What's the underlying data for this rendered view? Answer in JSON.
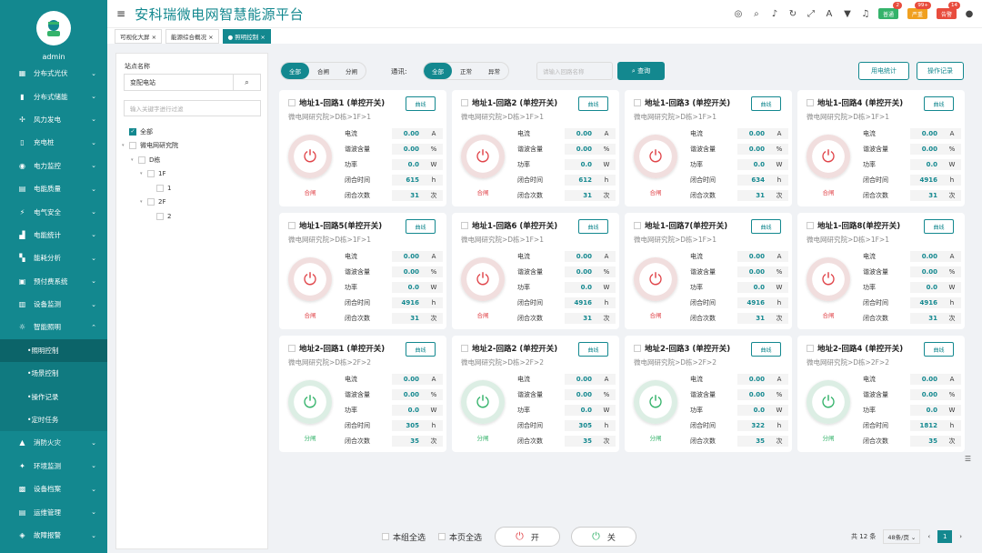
{
  "app": {
    "title": "安科瑞微电网智慧能源平台",
    "user": "admin"
  },
  "header_badges": [
    {
      "label": "普通",
      "count": "2",
      "color": "#35b36b"
    },
    {
      "label": "严重",
      "count": "99+",
      "color": "#f0a020"
    },
    {
      "label": "告警",
      "count": "14",
      "color": "#e84c3d"
    }
  ],
  "tabs": [
    "可视化大屏",
    "能源综合概况",
    "照明控制"
  ],
  "nav": [
    {
      "label": "分布式光伏",
      "icon": "solar-icon"
    },
    {
      "label": "分布式储能",
      "icon": "battery-icon"
    },
    {
      "label": "风力发电",
      "icon": "wind-icon"
    },
    {
      "label": "充电桩",
      "icon": "charger-icon"
    },
    {
      "label": "电力监控",
      "icon": "monitor-icon"
    },
    {
      "label": "电能质量",
      "icon": "quality-icon"
    },
    {
      "label": "电气安全",
      "icon": "safety-icon"
    },
    {
      "label": "电能统计",
      "icon": "stats-icon"
    },
    {
      "label": "能耗分析",
      "icon": "analysis-icon"
    },
    {
      "label": "预付费系统",
      "icon": "prepaid-icon"
    },
    {
      "label": "设备监测",
      "icon": "device-icon"
    },
    {
      "label": "智能照明",
      "icon": "bulb-icon"
    }
  ],
  "nav_sub": [
    "照明控制",
    "场景控制",
    "操作记录",
    "定时任务"
  ],
  "nav_after": [
    {
      "label": "消防火灾",
      "icon": "fire-icon"
    },
    {
      "label": "环境监测",
      "icon": "env-icon"
    },
    {
      "label": "设备档案",
      "icon": "archive-icon"
    },
    {
      "label": "运维管理",
      "icon": "maintenance-icon"
    },
    {
      "label": "故障报警",
      "icon": "alarm-icon"
    }
  ],
  "left": {
    "station_label": "站点名称",
    "station_value": "变配电站",
    "filter_placeholder": "输入关键字进行过滤",
    "tree": [
      "全部",
      "微电网研究院",
      "D栋",
      "1F",
      "1",
      "2F",
      "2"
    ]
  },
  "toolbar": {
    "filter1": [
      "全部",
      "合闸",
      "分闸"
    ],
    "comm_label": "通讯:",
    "filter2": [
      "全部",
      "正常",
      "异常"
    ],
    "search_placeholder": "请输入回路名称",
    "query": "查询",
    "usage_stats": "用电统计",
    "op_log": "操作记录"
  },
  "labels": {
    "current": "电流",
    "harmonic": "谐波含量",
    "power": "功率",
    "close_time": "闭合时间",
    "close_count": "闭合次数",
    "curve": "曲线"
  },
  "units": {
    "current": "A",
    "harmonic": "%",
    "power": "W",
    "close_time": "h",
    "close_count": "次"
  },
  "cards": [
    {
      "title": "地址1-回路1 (单控开关)",
      "path": "微电网研究院>D栋>1F>1",
      "state": "on",
      "state_label": "合闸",
      "current": "0.00",
      "harmonic": "0.00",
      "power": "0.0",
      "time": "615",
      "count": "31"
    },
    {
      "title": "地址1-回路2 (单控开关)",
      "path": "微电网研究院>D栋>1F>1",
      "state": "on",
      "state_label": "合闸",
      "current": "0.00",
      "harmonic": "0.00",
      "power": "0.0",
      "time": "612",
      "count": "31"
    },
    {
      "title": "地址1-回路3 (单控开关)",
      "path": "微电网研究院>D栋>1F>1",
      "state": "on",
      "state_label": "合闸",
      "current": "0.00",
      "harmonic": "0.00",
      "power": "0.0",
      "time": "634",
      "count": "31"
    },
    {
      "title": "地址1-回路4 (单控开关)",
      "path": "微电网研究院>D栋>1F>1",
      "state": "on",
      "state_label": "合闸",
      "current": "0.00",
      "harmonic": "0.00",
      "power": "0.0",
      "time": "4916",
      "count": "31"
    },
    {
      "title": "地址1-回路5(单控开关)",
      "path": "微电网研究院>D栋>1F>1",
      "state": "on",
      "state_label": "合闸",
      "current": "0.00",
      "harmonic": "0.00",
      "power": "0.0",
      "time": "4916",
      "count": "31"
    },
    {
      "title": "地址1-回路6 (单控开关)",
      "path": "微电网研究院>D栋>1F>1",
      "state": "on",
      "state_label": "合闸",
      "current": "0.00",
      "harmonic": "0.00",
      "power": "0.0",
      "time": "4916",
      "count": "31"
    },
    {
      "title": "地址1-回路7(单控开关)",
      "path": "微电网研究院>D栋>1F>1",
      "state": "on",
      "state_label": "合闸",
      "current": "0.00",
      "harmonic": "0.00",
      "power": "0.0",
      "time": "4916",
      "count": "31"
    },
    {
      "title": "地址1-回路8(单控开关)",
      "path": "微电网研究院>D栋>1F>1",
      "state": "on",
      "state_label": "合闸",
      "current": "0.00",
      "harmonic": "0.00",
      "power": "0.0",
      "time": "4916",
      "count": "31"
    },
    {
      "title": "地址2-回路1 (单控开关)",
      "path": "微电网研究院>D栋>2F>2",
      "state": "off",
      "state_label": "分闸",
      "current": "0.00",
      "harmonic": "0.00",
      "power": "0.0",
      "time": "305",
      "count": "35"
    },
    {
      "title": "地址2-回路2 (单控开关)",
      "path": "微电网研究院>D栋>2F>2",
      "state": "off",
      "state_label": "分闸",
      "current": "0.00",
      "harmonic": "0.00",
      "power": "0.0",
      "time": "305",
      "count": "35"
    },
    {
      "title": "地址2-回路3 (单控开关)",
      "path": "微电网研究院>D栋>2F>2",
      "state": "off",
      "state_label": "分闸",
      "current": "0.00",
      "harmonic": "0.00",
      "power": "0.0",
      "time": "322",
      "count": "35"
    },
    {
      "title": "地址2-回路4 (单控开关)",
      "path": "微电网研究院>D栋>2F>2",
      "state": "off",
      "state_label": "分闸",
      "current": "0.00",
      "harmonic": "0.00",
      "power": "0.0",
      "time": "1812",
      "count": "35"
    }
  ],
  "bottom": {
    "group_all": "本组全选",
    "page_all": "本页全选",
    "on": "开",
    "off": "关"
  },
  "pager": {
    "total": "共 12 条",
    "size": "48条/页",
    "page": "1"
  }
}
